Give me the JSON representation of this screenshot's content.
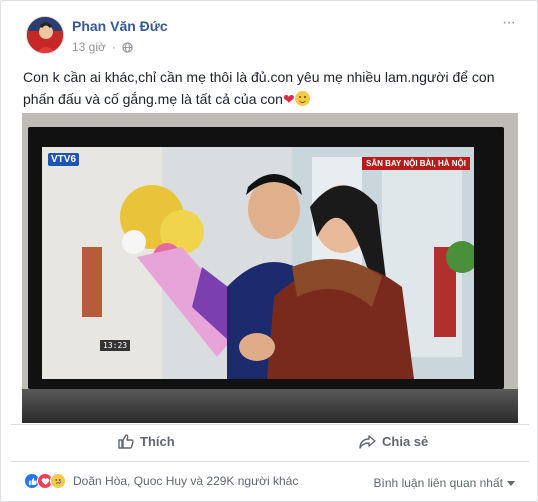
{
  "post": {
    "author": "Phan Văn Đức",
    "time": "13 giờ",
    "text": "Con k cần ai khác,chỉ cần mẹ thôi là đủ.con yêu mẹ nhiều lam.người để con phấn đấu và cố gắng.mẹ là tất cả của con",
    "menu": "···"
  },
  "tv_overlay": {
    "channel_logo": "VTV6",
    "caption": "SÂN BAY NỘI BÀI, HÀ NỘI",
    "timecode": "13:23"
  },
  "actions": {
    "like_label": "Thích",
    "share_label": "Chia sẻ"
  },
  "reactions": {
    "summary": "Doãn Hòa, Quoc Huy và 229K người khác",
    "sort_label": "Bình luận liên quan nhất",
    "icons": [
      "like-icon",
      "love-icon",
      "sad-icon"
    ]
  },
  "colors": {
    "author_link": "#385898",
    "like_blue": "#2078f4",
    "love_red": "#f33e58"
  }
}
